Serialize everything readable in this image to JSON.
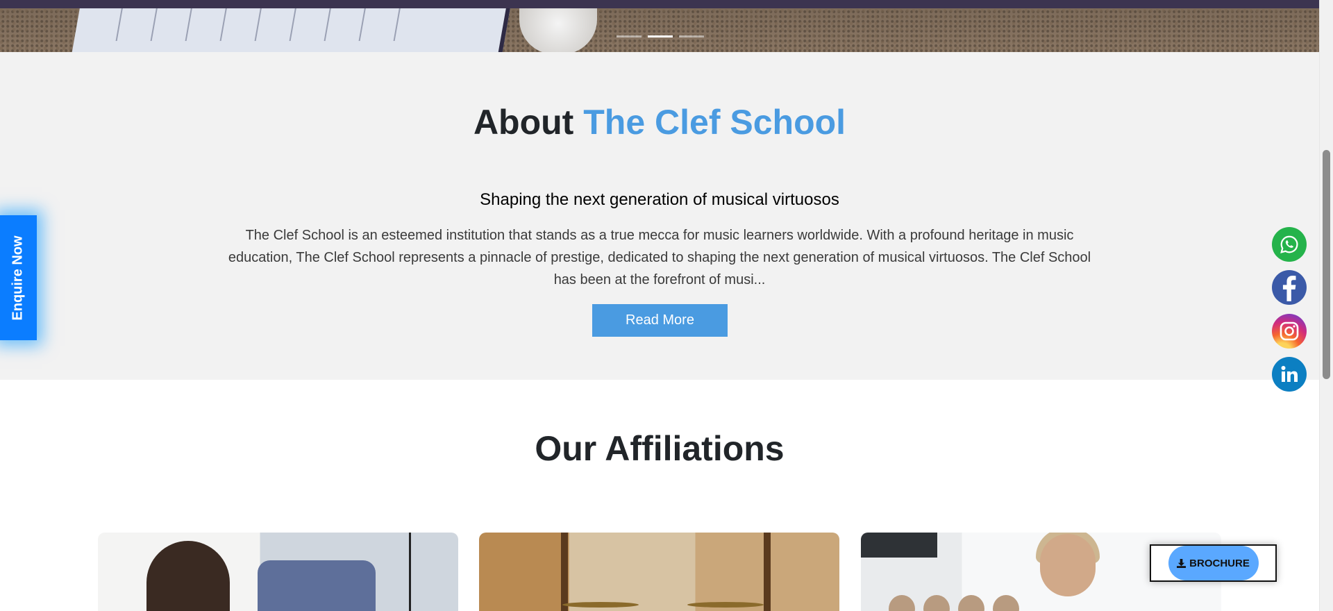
{
  "hero": {
    "carousel": {
      "count": 3,
      "active_index": 1
    }
  },
  "about": {
    "title_prefix": "About",
    "title_accent": "The Clef School",
    "subtitle": "Shaping the next generation of musical virtuosos",
    "body": "The Clef School is an esteemed institution that stands as a true mecca for music learners worldwide. With a profound heritage in music education, The Clef School represents a pinnacle of prestige, dedicated to shaping the next generation of musical virtuosos. The Clef School has been at the forefront of musi...",
    "read_more_label": "Read More"
  },
  "enquire": {
    "label": "Enquire Now"
  },
  "social": [
    {
      "name": "whatsapp",
      "icon": "whatsapp-icon",
      "color": "#25b34b"
    },
    {
      "name": "facebook",
      "icon": "facebook-icon",
      "color": "#3b5aa8"
    },
    {
      "name": "instagram",
      "icon": "instagram-icon",
      "color": "#d22b7c"
    },
    {
      "name": "linkedin",
      "icon": "linkedin-icon",
      "color": "#0c7fc2"
    }
  ],
  "affiliations": {
    "title": "Our Affiliations"
  },
  "brochure": {
    "label": "BROCHURE",
    "icon": "download-icon"
  },
  "colors": {
    "accent": "#4a9be1",
    "enquire": "#0b7dff",
    "about_bg": "#f2f2f2"
  }
}
